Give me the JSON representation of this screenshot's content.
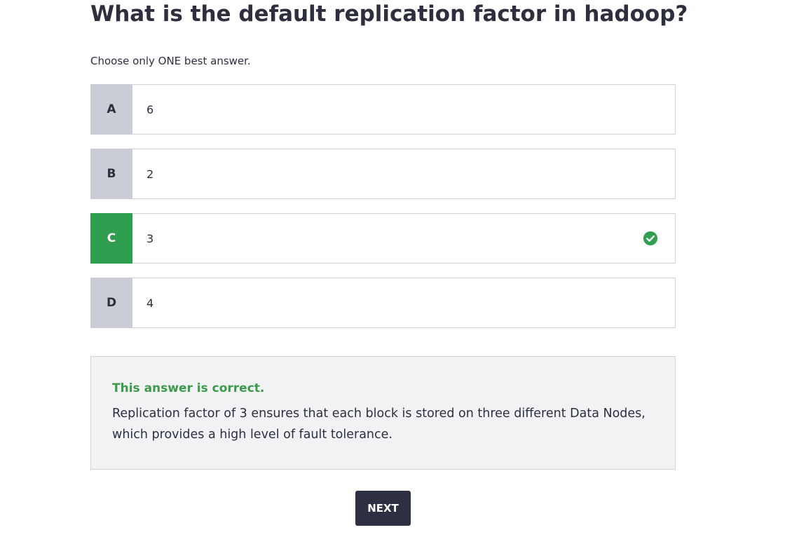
{
  "question": {
    "title": "What is the default replication factor in hadoop?",
    "instruction": "Choose only ONE best answer."
  },
  "options": [
    {
      "letter": "A",
      "text": "6",
      "correct": false
    },
    {
      "letter": "B",
      "text": "2",
      "correct": false
    },
    {
      "letter": "C",
      "text": "3",
      "correct": true
    },
    {
      "letter": "D",
      "text": "4",
      "correct": false
    }
  ],
  "feedback": {
    "title": "This answer is correct.",
    "text": "Replication factor of 3 ensures that each block is stored on three different Data Nodes, which provides a high level of fault tolerance."
  },
  "next_button": {
    "label": "NEXT"
  },
  "colors": {
    "correct": "#2f9e4f",
    "letter_bg": "#cacdd6",
    "text": "#2d2f3e",
    "button_bg": "#2d2f43",
    "feedback_bg": "#f1f2f4"
  },
  "icons": {
    "correct_indicator": "check-circle-icon"
  }
}
